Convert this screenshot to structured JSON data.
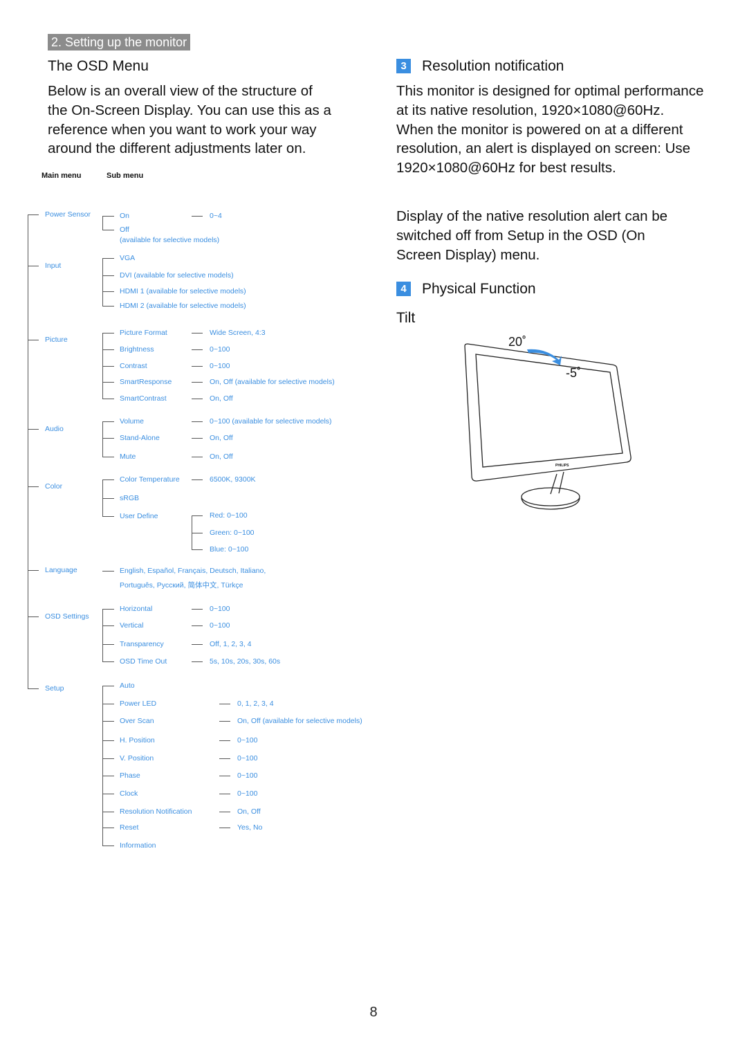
{
  "section_label": "2. Setting up the monitor",
  "left": {
    "title": "The OSD Menu",
    "intro": "Below is an overall view of the structure of the On-Screen Display. You can use this as a reference when you want to work your way around the different adjustments later on.",
    "col_main": "Main menu",
    "col_sub": "Sub menu",
    "tree": [
      {
        "label": "Power Sensor",
        "subs": [
          {
            "label": "On",
            "value": "0~4"
          },
          {
            "label": "Off"
          },
          {
            "label": "(available for selective models)",
            "note": true
          }
        ]
      },
      {
        "label": "Input",
        "subs": [
          {
            "label": "VGA"
          },
          {
            "label": "DVI (available for selective models)"
          },
          {
            "label": "HDMI 1 (available for selective models)"
          },
          {
            "label": "HDMI 2 (available for selective models)"
          }
        ]
      },
      {
        "label": "Picture",
        "subs": [
          {
            "label": "Picture Format",
            "value": "Wide Screen, 4:3"
          },
          {
            "label": "Brightness",
            "value": "0~100"
          },
          {
            "label": "Contrast",
            "value": "0~100"
          },
          {
            "label": "SmartResponse",
            "value": "On, Off (available for selective models)"
          },
          {
            "label": "SmartContrast",
            "value": "On, Off"
          }
        ]
      },
      {
        "label": "Audio",
        "subs": [
          {
            "label": "Volume",
            "value": "0~100 (available for selective models)"
          },
          {
            "label": "Stand-Alone",
            "value": "On, Off"
          },
          {
            "label": "Mute",
            "value": "On, Off"
          }
        ]
      },
      {
        "label": "Color",
        "subs": [
          {
            "label": "Color Temperature",
            "value": "6500K, 9300K"
          },
          {
            "label": "sRGB"
          },
          {
            "label": "User Define",
            "values": [
              "Red: 0~100",
              "Green: 0~100",
              "Blue: 0~100"
            ]
          }
        ]
      },
      {
        "label": "Language",
        "subs": [
          {
            "label": "English, Español, Français, Deutsch, Italiano,"
          },
          {
            "label": "Português, Русский, 简体中文, Türkçe",
            "note": true
          }
        ]
      },
      {
        "label": "OSD Settings",
        "subs": [
          {
            "label": "Horizontal",
            "value": "0~100"
          },
          {
            "label": "Vertical",
            "value": "0~100"
          },
          {
            "label": "Transparency",
            "value": "Off, 1, 2, 3, 4"
          },
          {
            "label": "OSD Time Out",
            "value": "5s, 10s, 20s, 30s, 60s"
          }
        ]
      },
      {
        "label": "Setup",
        "subs": [
          {
            "label": "Auto"
          },
          {
            "label": "Power LED",
            "value": "0, 1, 2, 3, 4"
          },
          {
            "label": "Over Scan",
            "value": "On, Off (available for selective models)"
          },
          {
            "label": "H. Position",
            "value": "0~100"
          },
          {
            "label": "V. Position",
            "value": "0~100"
          },
          {
            "label": "Phase",
            "value": "0~100"
          },
          {
            "label": "Clock",
            "value": "0~100"
          },
          {
            "label": "Resolution Notification",
            "value": "On, Off"
          },
          {
            "label": "Reset",
            "value": "Yes, No"
          },
          {
            "label": "Information"
          }
        ]
      }
    ]
  },
  "right": {
    "sec3_num": "3",
    "sec3_title": "Resolution notification",
    "sec3_p1": "This monitor is designed for optimal performance at its native resolution, 1920×1080@60Hz. When the monitor is powered on at a different resolution, an alert is displayed on screen: Use 1920×1080@60Hz for best results.",
    "sec3_p2": "Display of the native resolution alert can be switched off from Setup in the OSD (On Screen Display) menu.",
    "sec4_num": "4",
    "sec4_title": "Physical Function",
    "tilt_title": "Tilt",
    "tilt_up": "20˚",
    "tilt_down": "-5˚",
    "brand_logo": "PHILIPS"
  },
  "page_number": "8",
  "colors": {
    "accent": "#3a8ee0",
    "section_bar": "#8c8c8c"
  }
}
